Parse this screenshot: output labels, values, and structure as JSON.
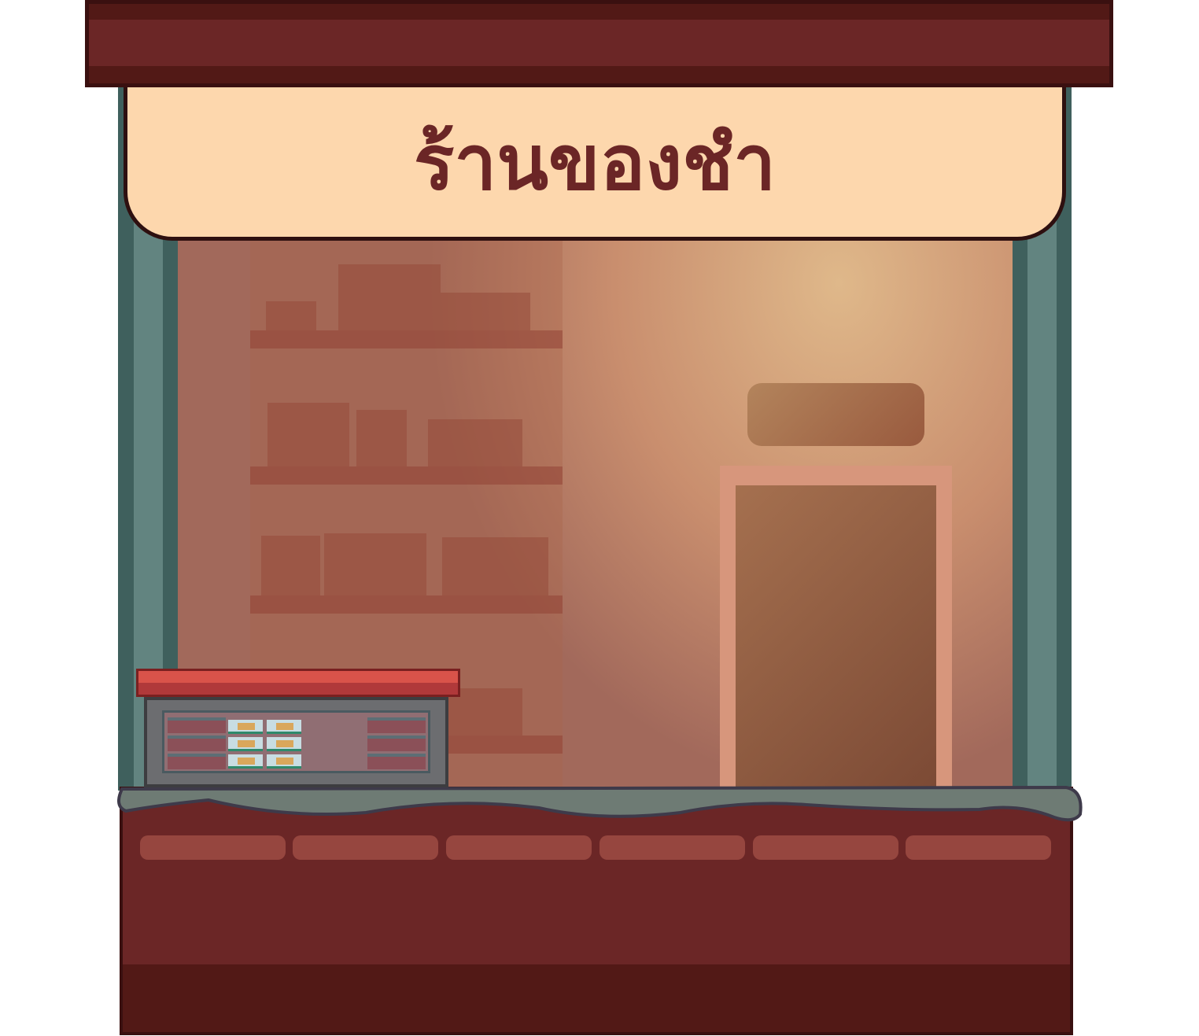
{
  "sign": {
    "title": "ร้านของชำ"
  },
  "colors": {
    "roof": "#6b2626",
    "sign_bg": "#fdd7ad",
    "post": "#628480",
    "counter": "#6b2626",
    "display_lid": "#d9534a"
  }
}
